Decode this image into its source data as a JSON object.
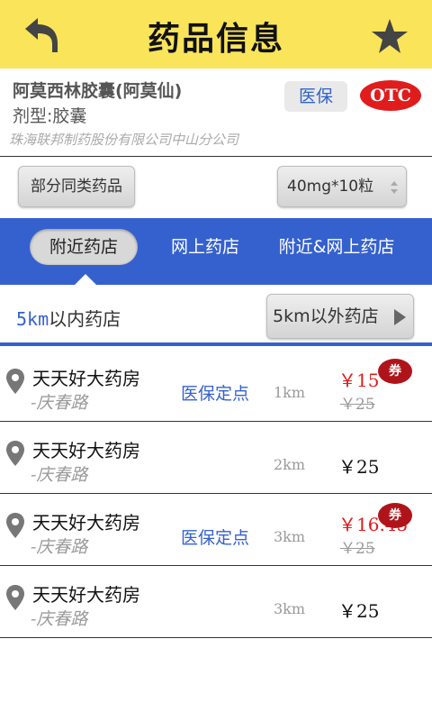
{
  "header": {
    "title": "药品信息",
    "back_icon": "back-arrow-icon",
    "favorite_icon": "star-icon"
  },
  "drug": {
    "name": "阿莫西林胶囊(阿莫仙)",
    "form": "剂型:胶囊",
    "manufacturer": "珠海联邦制药股份有限公司中山分公司",
    "insurance_badge": "医保",
    "otc_badge": "OTC"
  },
  "filters": {
    "similar_button": "部分同类药品",
    "spec_selected": "40mg*10粒"
  },
  "tabs": [
    {
      "label": "附近药店",
      "active": true
    },
    {
      "label": "网上药店",
      "active": false
    },
    {
      "label": "附近&网上药店",
      "active": false
    }
  ],
  "range": {
    "inner_km": "5km",
    "inner_suffix": "以内药店",
    "outer_button": "5km以外药店"
  },
  "stores": [
    {
      "name": "天天好大药房",
      "street": "-庆春路",
      "tag": "医保定点",
      "distance": "1km",
      "price": "￥15",
      "old_price": "￥25",
      "coupon": "券"
    },
    {
      "name": "天天好大药房",
      "street": "-庆春路",
      "tag": "",
      "distance": "2km",
      "price": "￥25"
    },
    {
      "name": "天天好大药房",
      "street": "-庆春路",
      "tag": "医保定点",
      "distance": "3km",
      "price": "￥16.45",
      "old_price": "￥25",
      "coupon": "券"
    },
    {
      "name": "天天好大药房",
      "street": "-庆春路",
      "tag": "",
      "distance": "3km",
      "price": "￥25"
    }
  ],
  "colors": {
    "header_bg": "#f9e45a",
    "accent_blue": "#3561cf",
    "sale_red": "#e01c1c",
    "coupon_red": "#b0141b"
  }
}
